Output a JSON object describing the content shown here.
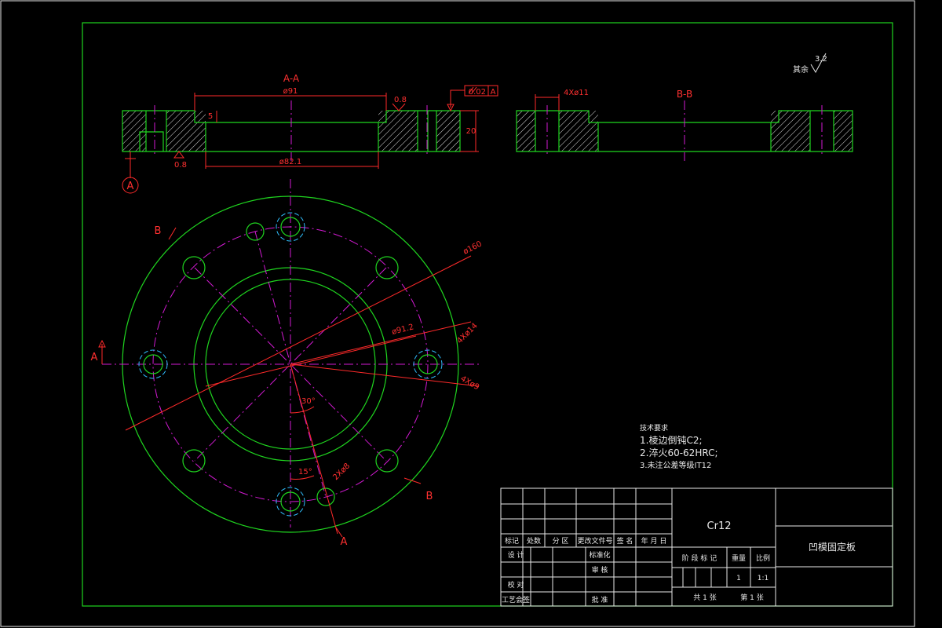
{
  "section_views": {
    "aa_label": "A-A",
    "bb_label": "B-B"
  },
  "dimensions": {
    "d91": "ø91",
    "d82": "ø82.1",
    "d160": "ø160",
    "d912": "ø91.2",
    "r08_top": "0.8",
    "r08_bottom": "0.8",
    "h5": "5",
    "h20": "20",
    "holes_11": "4Xø11",
    "holes_14": "4Xø14",
    "holes_9": "4Xø9",
    "pins": "2Xø8",
    "ang30": "30°",
    "ang15": "15°",
    "tol_value": "0.02",
    "tol_datum": "A",
    "datum_a": "A"
  },
  "section_marks": {
    "a": "A",
    "b": "B"
  },
  "roughness": {
    "label": "其余",
    "value": "3.2"
  },
  "tech_requirements": {
    "title": "技术要求",
    "items": [
      "1.棱边倒钝C2;",
      "2.淬火60-62HRC;",
      "3.未注公差等级IT12"
    ]
  },
  "title_block": {
    "material": "Cr12",
    "part_name": "凹模固定板",
    "headers": [
      "标记",
      "处数",
      "分 区",
      "更改文件号",
      "签 名",
      "年 月 日"
    ],
    "rows": {
      "design": "设 计",
      "standard": "标准化",
      "check": "校 对",
      "review": "审 核",
      "process": "工艺会签",
      "approve": "批 准"
    },
    "stage_label": "阶 段 标 记",
    "weight_label": "重量",
    "scale_label": "比例",
    "weight_value": "1",
    "scale_value": "1:1",
    "sheets_total": "共 1 张",
    "sheet_no": "第 1 张"
  }
}
